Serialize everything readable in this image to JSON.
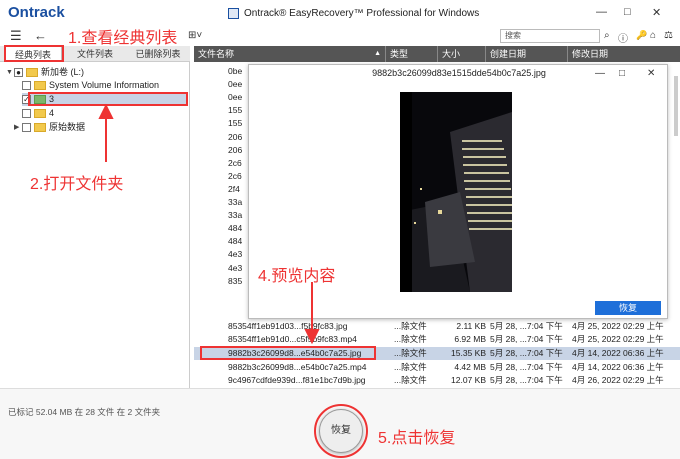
{
  "app": {
    "logo": "Ontrack",
    "title": "Ontrack® EasyRecovery™ Professional for Windows",
    "controls": {
      "minimize": "—",
      "maximize": "□",
      "close": "✕"
    }
  },
  "toolbar": {
    "menu_icon": "☰",
    "back_icon": "←",
    "view_icon": "⊞˅",
    "search_placeholder": "搜索",
    "right_icons": [
      "ⓘ",
      "🔑",
      "⌂",
      "⚖"
    ]
  },
  "left_tabs": [
    "经典列表",
    "文件列表",
    "已删除列表"
  ],
  "tree": [
    {
      "label": "新加卷 (L:)"
    },
    {
      "label": "System Volume Information"
    },
    {
      "label": "3"
    },
    {
      "label": "4"
    },
    {
      "label": "原始数据"
    }
  ],
  "columns": [
    "文件名称",
    "类型",
    "大小",
    "创建日期",
    "修改日期"
  ],
  "partial_rows": [
    "0be",
    "0ee",
    "0ee",
    "155",
    "155",
    "206",
    "206",
    "2c6",
    "2c6",
    "2f4",
    "33a",
    "33a",
    "484",
    "484",
    "4e3",
    "4e3",
    "835"
  ],
  "full_rows": [
    {
      "name": "85354ff1eb91d03...f5b9fc83.jpg",
      "type": "...除文件",
      "size": "2.11 KB",
      "created": "5月 28, ...7:04 下午",
      "modified": "4月 25, 2022 02:29 上午"
    },
    {
      "name": "85354ff1eb91d0...c5f5b9fc83.mp4",
      "type": "...除文件",
      "size": "6.92 MB",
      "created": "5月 28, ...7:04 下午",
      "modified": "4月 25, 2022 02:29 上午"
    },
    {
      "name": "9882b3c26099d8...e54b0c7a25.jpg",
      "type": "...除文件",
      "size": "15.35 KB",
      "created": "5月 28, ...7:04 下午",
      "modified": "4月 14, 2022 06:36 上午"
    },
    {
      "name": "9882b3c26099d8...e54b0c7a25.mp4",
      "type": "...除文件",
      "size": "4.42 MB",
      "created": "5月 28, ...7:04 下午",
      "modified": "4月 14, 2022 06:36 上午"
    },
    {
      "name": "9c4967cdfde939d...f81e1bc7d9b.jpg",
      "type": "...除文件",
      "size": "12.07 KB",
      "created": "5月 28, ...7:04 下午",
      "modified": "4月 26, 2022 02:29 上午"
    }
  ],
  "preview": {
    "title": "9882b3c26099d83e1515dde54b0c7a25.jpg",
    "recover_label": "恢复"
  },
  "status": "已标记 52.04 MB 在 28 文件 在 2 文件夹",
  "recover_button": "恢复",
  "annotations": {
    "step1": "1.查看经典列表",
    "step2": "2.打开文件夹",
    "step4": "4.预览内容",
    "step5": "5.点击恢复"
  },
  "colors": {
    "annotation": "#e33333",
    "accent": "#1e6fd9",
    "header": "#555555",
    "selection": "#c8d4e6"
  }
}
